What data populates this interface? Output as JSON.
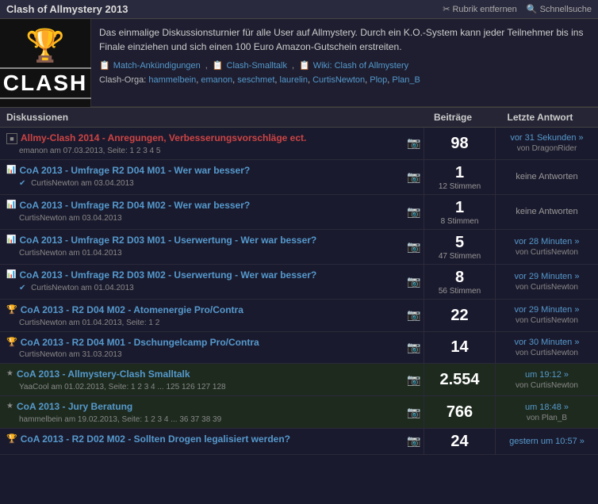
{
  "header": {
    "title": "Clash of Allmystery 2013",
    "rubrik_label": "Rubrik entfernen",
    "schnellsuche_label": "Schnellsuche"
  },
  "info": {
    "description": "Das einmalige Diskussionsturnier für alle User auf Allmystery. Durch ein K.O.-System kann jeder Teilnehmer bis ins Finale einziehen und sich einen 100 Euro Amazon-Gutschein erstreiten.",
    "links": [
      {
        "icon": "📋",
        "text": "Match-Ankündigungen"
      },
      {
        "icon": "📋",
        "text": "Clash-Smalltalk"
      },
      {
        "icon": "📋",
        "text": "Wiki: Clash of Allmystery"
      }
    ],
    "orga_label": "Clash-Orga:",
    "orga_users": [
      "hammelbein",
      "emanon",
      "seschmet",
      "laurelin",
      "CurtisNewton",
      "Plop",
      "Plan_B"
    ]
  },
  "table": {
    "col_discussions": "Diskussionen",
    "col_beitraege": "Beiträge",
    "col_letzte": "Letzte Antwort"
  },
  "rows": [
    {
      "icon_type": "box",
      "title": "Allmy-Clash 2014 - Anregungen, Verbesserungsvorschläge ect.",
      "title_color": "red",
      "meta": "emanon am 07.03.2013, Seite: 1 2 3 4 5",
      "beitraege": "98",
      "beitraege_sub": "",
      "letzte_time": "vor 31 Sekunden »",
      "letzte_von": "von DragonRider",
      "highlight": false
    },
    {
      "icon_type": "q",
      "title": "CoA 2013 - Umfrage R2 D04 M01 - Wer war besser?",
      "title_color": "normal",
      "meta": "CurtisNewton am 03.04.2013",
      "check": true,
      "beitraege": "1",
      "beitraege_sub": "12 Stimmen",
      "letzte_time": "keine Antworten",
      "letzte_von": "",
      "highlight": false
    },
    {
      "icon_type": "q",
      "title": "CoA 2013 - Umfrage R2 D04 M02 - Wer war besser?",
      "title_color": "normal",
      "meta": "CurtisNewton am 03.04.2013",
      "beitraege": "1",
      "beitraege_sub": "8 Stimmen",
      "letzte_time": "keine Antworten",
      "letzte_von": "",
      "highlight": false
    },
    {
      "icon_type": "q",
      "title": "CoA 2013 - Umfrage R2 D03 M01 - Userwertung - Wer war besser?",
      "title_color": "normal",
      "meta": "CurtisNewton am 01.04.2013",
      "beitraege": "5",
      "beitraege_sub": "47 Stimmen",
      "letzte_time": "vor 28 Minuten »",
      "letzte_von": "von CurtisNewton",
      "highlight": false
    },
    {
      "icon_type": "q",
      "title": "CoA 2013 - Umfrage R2 D03 M02 - Userwertung - Wer war besser?",
      "title_color": "normal",
      "meta": "CurtisNewton am 01.04.2013",
      "check": true,
      "beitraege": "8",
      "beitraege_sub": "56 Stimmen",
      "letzte_time": "vor 29 Minuten »",
      "letzte_von": "von CurtisNewton",
      "highlight": false
    },
    {
      "icon_type": "trophy",
      "title": "CoA 2013 - R2 D04 M02 - Atomenergie Pro/Contra",
      "title_color": "normal",
      "meta": "CurtisNewton am 01.04.2013, Seite: 1 2",
      "beitraege": "22",
      "beitraege_sub": "",
      "letzte_time": "vor 29 Minuten »",
      "letzte_von": "von CurtisNewton",
      "highlight": false
    },
    {
      "icon_type": "trophy",
      "title": "CoA 2013 - R2 D04 M01 - Dschungelcamp Pro/Contra",
      "title_color": "normal",
      "meta": "CurtisNewton am 31.03.2013",
      "beitraege": "14",
      "beitraege_sub": "",
      "letzte_time": "vor 30 Minuten »",
      "letzte_von": "von CurtisNewton",
      "highlight": false
    },
    {
      "icon_type": "star",
      "title": "CoA 2013 - Allmystery-Clash Smalltalk",
      "title_color": "normal",
      "meta": "YaaCool am 01.02.2013, Seite: 1 2 3 4 ... 125 126 127 128",
      "beitraege": "2.554",
      "beitraege_sub": "",
      "letzte_time": "um 19:12 »",
      "letzte_von": "von CurtisNewton",
      "highlight": true
    },
    {
      "icon_type": "star",
      "title": "CoA 2013 - Jury Beratung",
      "title_color": "normal",
      "meta": "hammelbein am 19.02.2013, Seite: 1 2 3 4 ... 36 37 38 39",
      "beitraege": "766",
      "beitraege_sub": "",
      "letzte_time": "um 18:48 »",
      "letzte_von": "von Plan_B",
      "highlight": true
    },
    {
      "icon_type": "trophy",
      "title": "CoA 2013 - R2 D02 M02 - Sollten Drogen legalisiert werden?",
      "title_color": "normal",
      "meta": "",
      "beitraege": "24",
      "beitraege_sub": "",
      "letzte_time": "gestern um 10:57 »",
      "letzte_von": "",
      "highlight": false
    }
  ]
}
